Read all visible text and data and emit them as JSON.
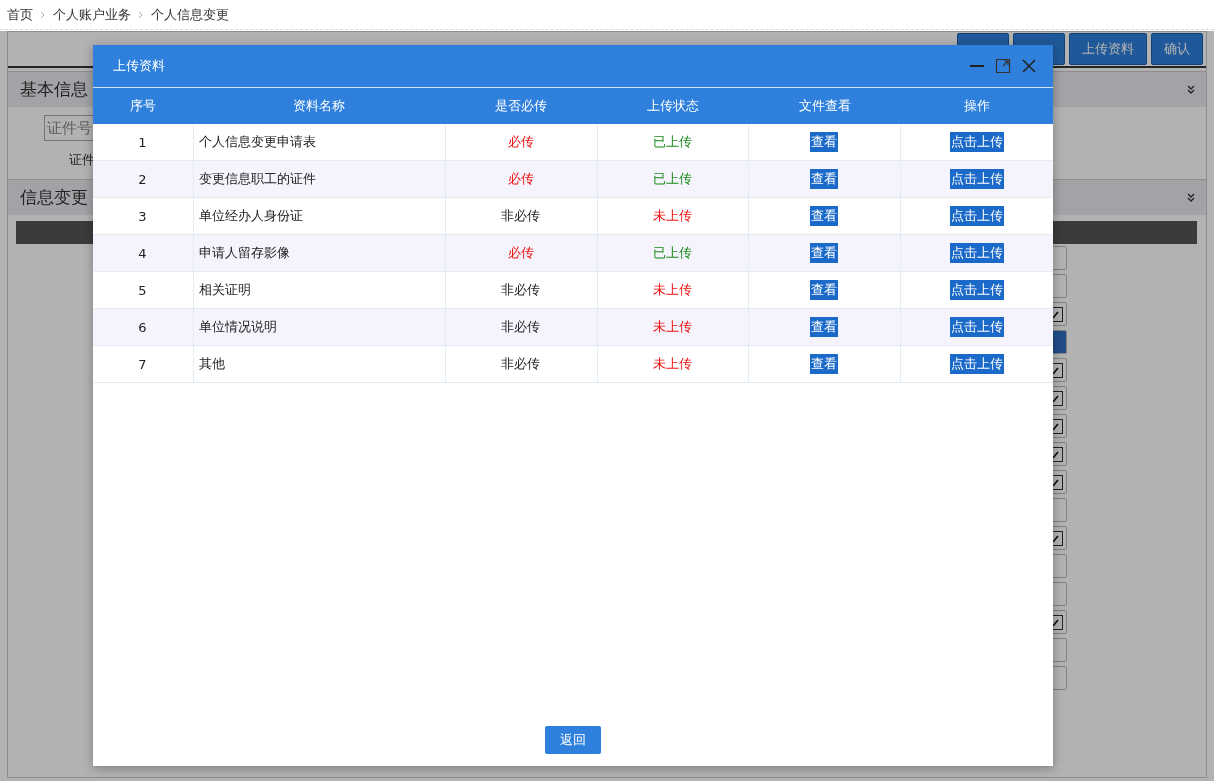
{
  "breadcrumb": [
    "首页",
    "个人账户业务",
    "个人信息变更"
  ],
  "toolbar": {
    "buttons": [
      {
        "kind": "covered"
      },
      {
        "kind": "covered"
      },
      {
        "label": "上传资料",
        "kind": "normal"
      },
      {
        "label": "确认",
        "kind": "normal"
      }
    ]
  },
  "sections": [
    {
      "title": "基本信息",
      "expanded": true,
      "fields": [
        {
          "placeholder": "证件号"
        },
        {
          "label": "证件"
        }
      ]
    },
    {
      "title": "信息变更",
      "expanded": true
    }
  ],
  "side_fields": [
    {
      "kind": "field"
    },
    {
      "kind": "field"
    },
    {
      "kind": "check"
    },
    {
      "kind": "button"
    },
    {
      "kind": "check"
    },
    {
      "kind": "check"
    },
    {
      "kind": "check"
    },
    {
      "kind": "check"
    },
    {
      "kind": "check"
    },
    {
      "kind": "field"
    },
    {
      "kind": "check"
    },
    {
      "kind": "field"
    },
    {
      "kind": "field"
    },
    {
      "kind": "check"
    },
    {
      "kind": "field"
    },
    {
      "kind": "field"
    }
  ],
  "dialog": {
    "title": "上传资料",
    "columns": [
      "序号",
      "资料名称",
      "是否必传",
      "上传状态",
      "文件查看",
      "操作"
    ],
    "rows": [
      {
        "index": "1",
        "name": "个人信息变更申请表",
        "required": "必传",
        "is_required": true,
        "status": "已上传",
        "uploaded": true,
        "view": "查看",
        "action": "点击上传"
      },
      {
        "index": "2",
        "name": "变更信息职工的证件",
        "required": "必传",
        "is_required": true,
        "status": "已上传",
        "uploaded": true,
        "view": "查看",
        "action": "点击上传"
      },
      {
        "index": "3",
        "name": "单位经办人身份证",
        "required": "非必传",
        "is_required": false,
        "status": "未上传",
        "uploaded": false,
        "view": "查看",
        "action": "点击上传"
      },
      {
        "index": "4",
        "name": "申请人留存影像",
        "required": "必传",
        "is_required": true,
        "status": "已上传",
        "uploaded": true,
        "view": "查看",
        "action": "点击上传"
      },
      {
        "index": "5",
        "name": "相关证明",
        "required": "非必传",
        "is_required": false,
        "status": "未上传",
        "uploaded": false,
        "view": "查看",
        "action": "点击上传"
      },
      {
        "index": "6",
        "name": "单位情况说明",
        "required": "非必传",
        "is_required": false,
        "status": "未上传",
        "uploaded": false,
        "view": "查看",
        "action": "点击上传"
      },
      {
        "index": "7",
        "name": "其他",
        "required": "非必传",
        "is_required": false,
        "status": "未上传",
        "uploaded": false,
        "view": "查看",
        "action": "点击上传"
      }
    ],
    "footer_button": "返回"
  }
}
